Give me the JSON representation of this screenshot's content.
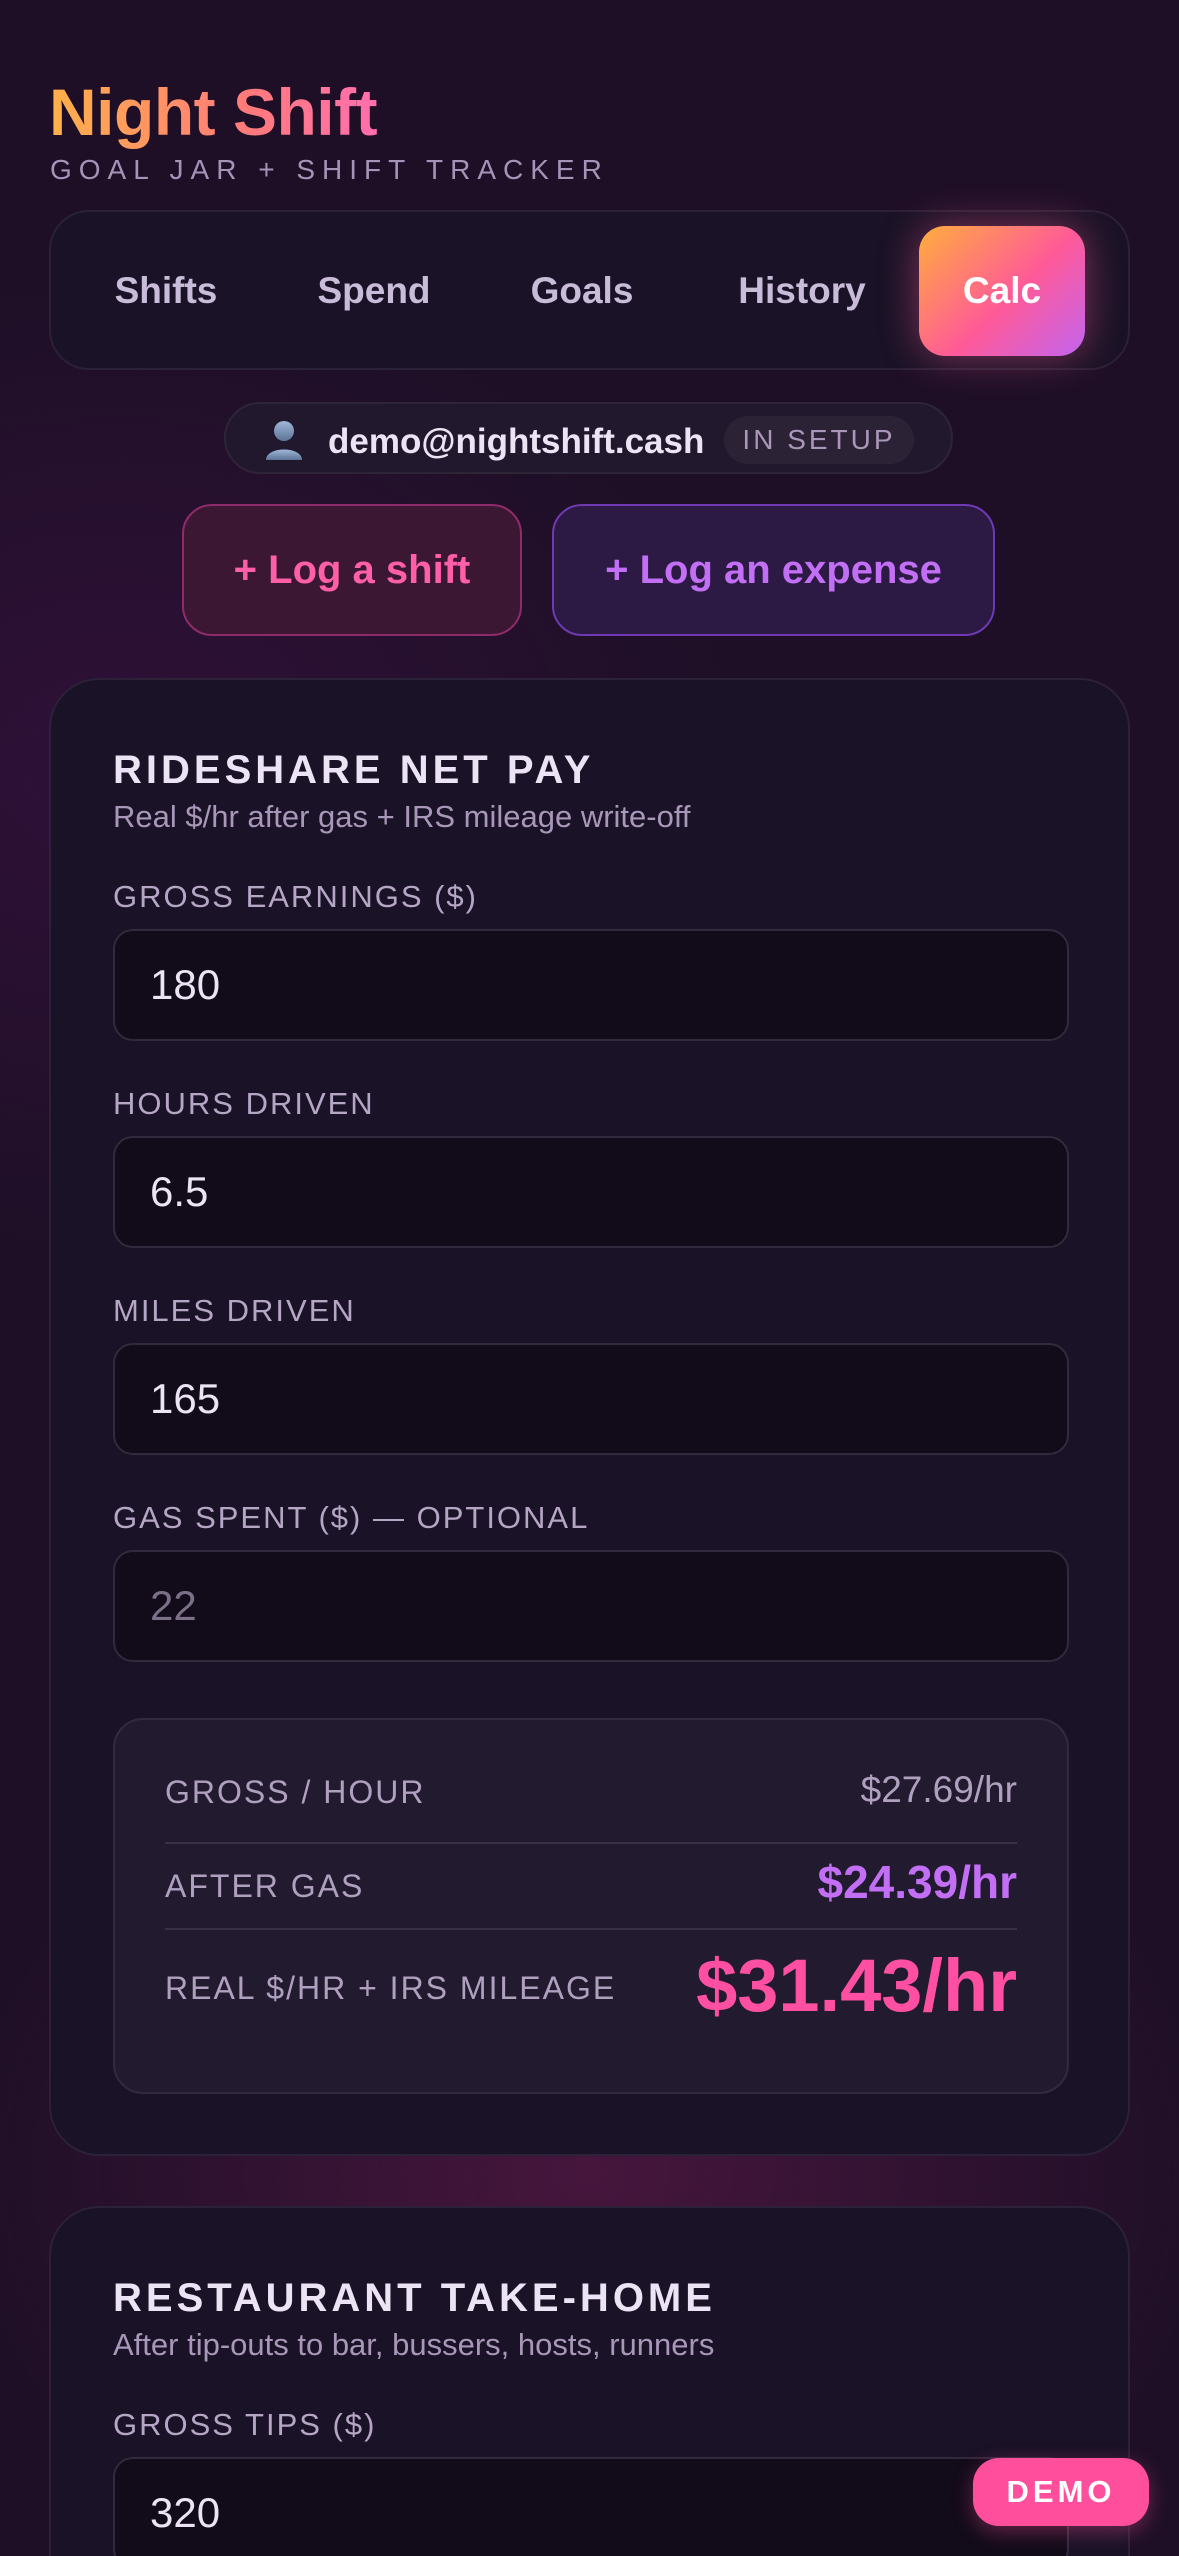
{
  "header": {
    "title": "Night Shift",
    "subtitle": "GOAL JAR + SHIFT TRACKER"
  },
  "nav": {
    "tabs": [
      {
        "label": "Shifts"
      },
      {
        "label": "Spend"
      },
      {
        "label": "Goals"
      },
      {
        "label": "History"
      },
      {
        "label": "Calc",
        "active": true
      }
    ]
  },
  "account": {
    "email": "demo@nightshift.cash",
    "status": "IN SETUP"
  },
  "actions": {
    "log_shift": "+ Log a shift",
    "log_expense": "+ Log an expense"
  },
  "rideshare": {
    "title": "RIDESHARE NET PAY",
    "subtitle": "Real $/hr after gas + IRS mileage write-off",
    "fields": {
      "gross_label": "GROSS EARNINGS ($)",
      "gross_value": "180",
      "hours_label": "HOURS DRIVEN",
      "hours_value": "6.5",
      "miles_label": "MILES DRIVEN",
      "miles_value": "165",
      "gas_label": "GAS SPENT ($) — OPTIONAL",
      "gas_placeholder": "22"
    },
    "results": {
      "gross_hour_label": "GROSS / HOUR",
      "gross_hour_value": "$27.69/hr",
      "after_gas_label": "AFTER GAS",
      "after_gas_value": "$24.39/hr",
      "real_label": "REAL $/HR + IRS MILEAGE",
      "real_value": "$31.43/hr"
    }
  },
  "restaurant": {
    "title": "RESTAURANT TAKE-HOME",
    "subtitle": "After tip-outs to bar, bussers, hosts, runners",
    "tips_label": "GROSS TIPS ($)",
    "tips_value": "320"
  },
  "badge": {
    "label": "DEMO"
  },
  "colors": {
    "background": "#1e0f26",
    "card": "#1a1226",
    "accent_pink": "#ff4fa2",
    "accent_purple": "#c26ff5",
    "accent_orange": "#ffae3c"
  },
  "icons": {
    "account": "user-icon"
  }
}
